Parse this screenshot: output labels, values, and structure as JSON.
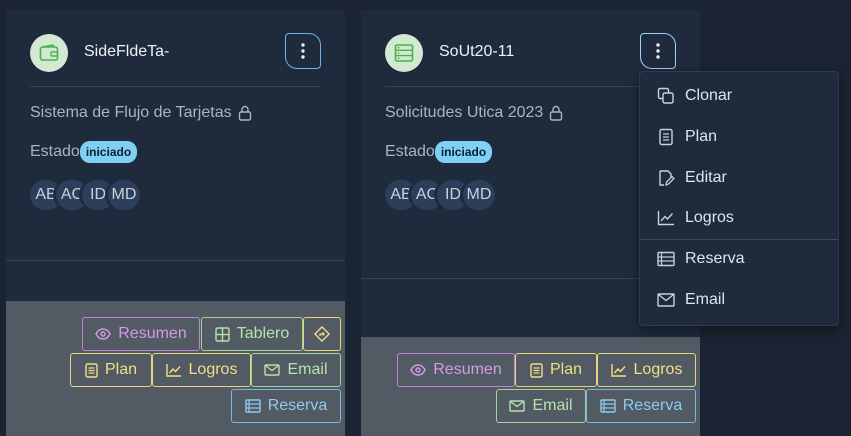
{
  "cards": [
    {
      "title": "SideFldeTa-",
      "icon": "wallet-icon",
      "description": "Sistema de Flujo de Tarjetas",
      "status_label": "Estado",
      "status_badge": "iniciado",
      "people": [
        "AB",
        "AC",
        "ID",
        "MD"
      ],
      "actions": {
        "resumen": "Resumen",
        "tablero": "Tablero",
        "plan": "Plan",
        "logros": "Logros",
        "email": "Email",
        "reserva": "Reserva"
      }
    },
    {
      "title": "SoUt20-11",
      "icon": "server-icon",
      "description": "Solicitudes Utica 2023",
      "status_label": "Estado",
      "status_badge": "iniciado",
      "people": [
        "AB",
        "AC",
        "ID",
        "MD"
      ],
      "actions": {
        "resumen": "Resumen",
        "plan": "Plan",
        "logros": "Logros",
        "email": "Email",
        "reserva": "Reserva"
      }
    }
  ],
  "menu": {
    "items": [
      {
        "label": "Clonar",
        "icon": "copy-icon"
      },
      {
        "label": "Plan",
        "icon": "document-icon"
      },
      {
        "label": "Editar",
        "icon": "edit-icon"
      },
      {
        "label": "Logros",
        "icon": "chart-icon"
      },
      {
        "label": "Reserva",
        "icon": "list-icon"
      },
      {
        "label": "Email",
        "icon": "mail-icon"
      }
    ]
  },
  "colors": {
    "background": "#1b2432",
    "card": "#1f2b3d",
    "footer": "#525a63",
    "badge": "#7fd0f5",
    "purple": "#c184d6",
    "green": "#a7d39a",
    "yellow": "#e6d37c",
    "blue": "#77b7e3"
  }
}
